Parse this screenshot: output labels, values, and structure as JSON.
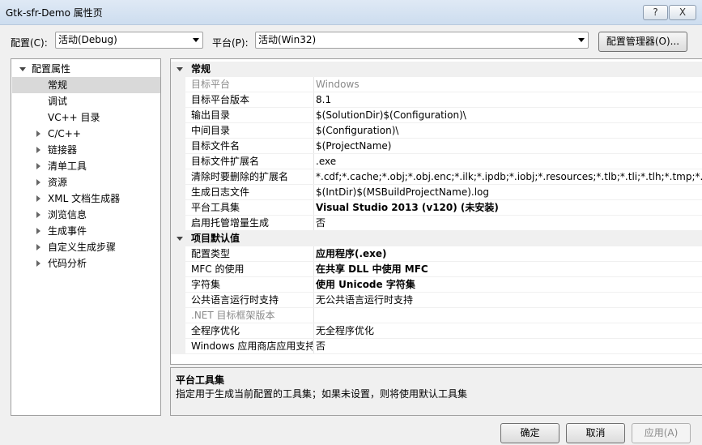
{
  "window": {
    "title": "Gtk-sfr-Demo 属性页",
    "help_label": "?",
    "close_label": "X"
  },
  "config_row": {
    "config_label": "配置(C):",
    "config_value": "活动(Debug)",
    "platform_label": "平台(P):",
    "platform_value": "活动(Win32)",
    "config_manager_label": "配置管理器(O)..."
  },
  "tree": {
    "root": "配置属性",
    "items": [
      {
        "label": "常规",
        "selected": true,
        "expandable": false
      },
      {
        "label": "调试",
        "selected": false,
        "expandable": false
      },
      {
        "label": "VC++ 目录",
        "selected": false,
        "expandable": false
      },
      {
        "label": "C/C++",
        "selected": false,
        "expandable": true
      },
      {
        "label": "链接器",
        "selected": false,
        "expandable": true
      },
      {
        "label": "清单工具",
        "selected": false,
        "expandable": true
      },
      {
        "label": "资源",
        "selected": false,
        "expandable": true
      },
      {
        "label": "XML 文档生成器",
        "selected": false,
        "expandable": true
      },
      {
        "label": "浏览信息",
        "selected": false,
        "expandable": true
      },
      {
        "label": "生成事件",
        "selected": false,
        "expandable": true
      },
      {
        "label": "自定义生成步骤",
        "selected": false,
        "expandable": true
      },
      {
        "label": "代码分析",
        "selected": false,
        "expandable": true
      }
    ]
  },
  "grid": {
    "categories": [
      {
        "name": "常规",
        "props": [
          {
            "name": "目标平台",
            "value": "Windows",
            "gray": true,
            "bold": false
          },
          {
            "name": "目标平台版本",
            "value": "8.1",
            "gray": false,
            "bold": false
          },
          {
            "name": "输出目录",
            "value": "$(SolutionDir)$(Configuration)\\",
            "gray": false,
            "bold": false
          },
          {
            "name": "中间目录",
            "value": "$(Configuration)\\",
            "gray": false,
            "bold": false
          },
          {
            "name": "目标文件名",
            "value": "$(ProjectName)",
            "gray": false,
            "bold": false
          },
          {
            "name": "目标文件扩展名",
            "value": ".exe",
            "gray": false,
            "bold": false
          },
          {
            "name": "清除时要删除的扩展名",
            "value": "*.cdf;*.cache;*.obj;*.obj.enc;*.ilk;*.ipdb;*.iobj;*.resources;*.tlb;*.tli;*.tlh;*.tmp;*.rsp;*",
            "gray": false,
            "bold": false
          },
          {
            "name": "生成日志文件",
            "value": "$(IntDir)$(MSBuildProjectName).log",
            "gray": false,
            "bold": false
          },
          {
            "name": "平台工具集",
            "value": "Visual Studio 2013 (v120) (未安装)",
            "gray": false,
            "bold": true
          },
          {
            "name": "启用托管增量生成",
            "value": "否",
            "gray": false,
            "bold": false
          }
        ]
      },
      {
        "name": "项目默认值",
        "props": [
          {
            "name": "配置类型",
            "value": "应用程序(.exe)",
            "gray": false,
            "bold": true
          },
          {
            "name": "MFC 的使用",
            "value": "在共享 DLL 中使用 MFC",
            "gray": false,
            "bold": true
          },
          {
            "name": "字符集",
            "value": "使用 Unicode 字符集",
            "gray": false,
            "bold": true
          },
          {
            "name": "公共语言运行时支持",
            "value": "无公共语言运行时支持",
            "gray": false,
            "bold": false
          },
          {
            "name": ".NET 目标框架版本",
            "value": "",
            "gray": true,
            "bold": false
          },
          {
            "name": "全程序优化",
            "value": "无全程序优化",
            "gray": false,
            "bold": false
          },
          {
            "name": "Windows 应用商店应用支持",
            "value": "否",
            "gray": false,
            "bold": false
          }
        ]
      }
    ]
  },
  "description": {
    "title": "平台工具集",
    "text": "指定用于生成当前配置的工具集；如果未设置，则将使用默认工具集"
  },
  "buttons": {
    "ok": "确定",
    "cancel": "取消",
    "apply": "应用(A)"
  }
}
